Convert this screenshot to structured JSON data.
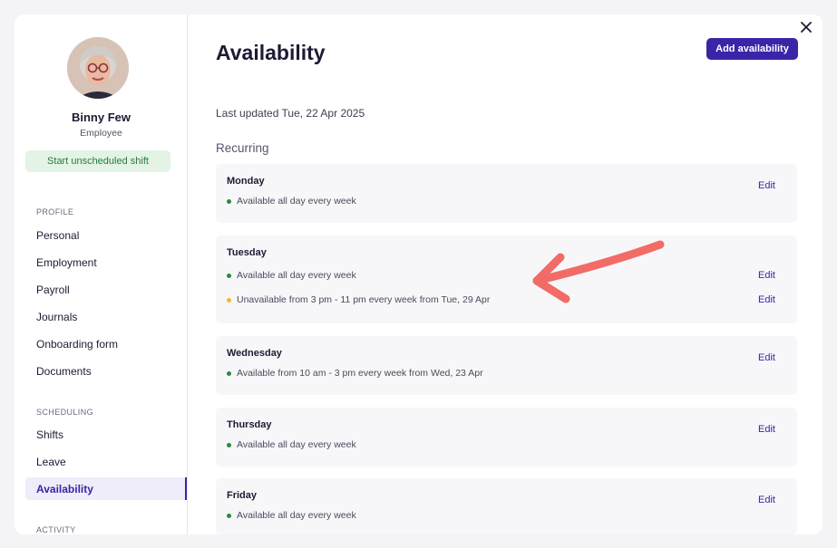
{
  "profile": {
    "name": "Binny Few",
    "role": "Employee",
    "start_shift_label": "Start unscheduled shift"
  },
  "sidebar": {
    "sections": [
      {
        "label": "PROFILE",
        "items": [
          "Personal",
          "Employment",
          "Payroll",
          "Journals",
          "Onboarding form",
          "Documents"
        ]
      },
      {
        "label": "SCHEDULING",
        "items": [
          "Shifts",
          "Leave",
          "Availability"
        ]
      },
      {
        "label": "ACTIVITY",
        "items": []
      }
    ],
    "active_item": "Availability"
  },
  "main": {
    "title": "Availability",
    "add_button_label": "Add availability",
    "last_updated": "Last updated Tue, 22 Apr 2025",
    "recurring_heading": "Recurring",
    "edit_label": "Edit",
    "days": [
      {
        "name": "Monday",
        "slots": [
          {
            "text": "Available all day every week",
            "status": "available"
          }
        ]
      },
      {
        "name": "Tuesday",
        "slots": [
          {
            "text": "Available all day every week",
            "status": "available"
          },
          {
            "text": "Unavailable from 3 pm - 11 pm every week from Tue, 29 Apr",
            "status": "unavailable"
          }
        ]
      },
      {
        "name": "Wednesday",
        "slots": [
          {
            "text": "Available from 10 am - 3 pm every week from Wed, 23 Apr",
            "status": "available"
          }
        ]
      },
      {
        "name": "Thursday",
        "slots": [
          {
            "text": "Available all day every week",
            "status": "available"
          }
        ]
      },
      {
        "name": "Friday",
        "slots": [
          {
            "text": "Available all day every week",
            "status": "available"
          }
        ]
      }
    ]
  },
  "colors": {
    "accent": "#3a24a8",
    "available": "#2e8b3c",
    "unavailable": "#f2b824",
    "arrow": "#f26b66"
  },
  "icons": {
    "close": "close-icon",
    "annotation": "arrow-annotation"
  }
}
